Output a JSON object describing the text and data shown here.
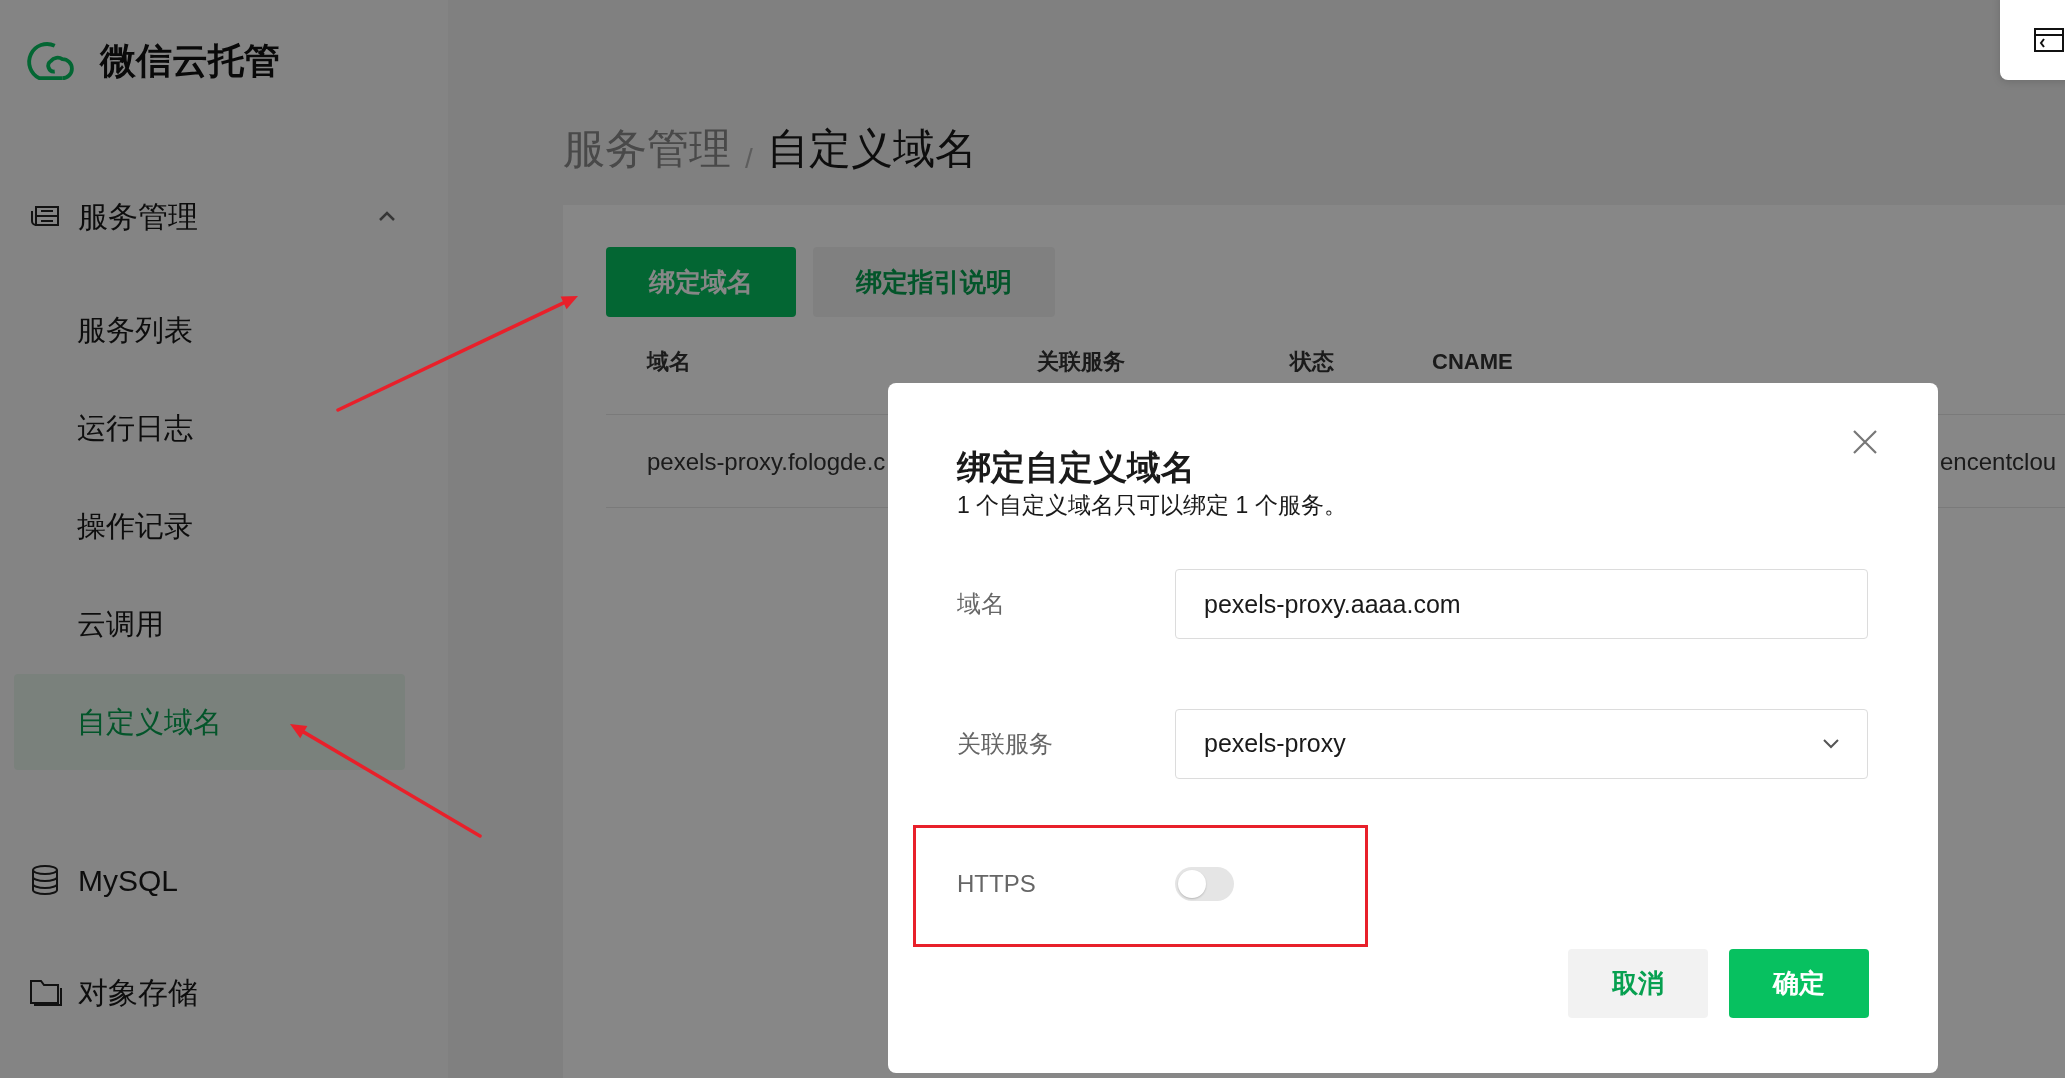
{
  "logo": {
    "text": "微信云托管"
  },
  "sidebar": {
    "groups": [
      {
        "label": "服务管理",
        "expanded": true,
        "items": [
          {
            "label": "服务列表",
            "selected": false
          },
          {
            "label": "运行日志",
            "selected": false
          },
          {
            "label": "操作记录",
            "selected": false
          },
          {
            "label": "云调用",
            "selected": false
          },
          {
            "label": "自定义域名",
            "selected": true
          }
        ]
      },
      {
        "label": "MySQL"
      },
      {
        "label": "对象存储"
      }
    ]
  },
  "breadcrumb": {
    "items": [
      "服务管理",
      "自定义域名"
    ],
    "separator": "/"
  },
  "actions": [
    {
      "label": "绑定域名",
      "kind": "primary"
    },
    {
      "label": "绑定指引说明",
      "kind": "secondary"
    }
  ],
  "table": {
    "columns": [
      "域名",
      "关联服务",
      "状态",
      "CNAME"
    ],
    "rows": [
      {
        "domain": "pexels-proxy.fologde.c",
        "trailing_cell": "encentclou"
      }
    ]
  },
  "modal": {
    "title": "绑定自定义域名",
    "subtitle": "1 个自定义域名只可以绑定 1 个服务。",
    "fields": [
      {
        "kind": "text",
        "label": "域名",
        "value": "pexels-proxy.aaaa.com"
      },
      {
        "kind": "select",
        "label": "关联服务",
        "value": "pexels-proxy"
      },
      {
        "kind": "switch",
        "label": "HTTPS",
        "on": false
      }
    ],
    "buttons": [
      {
        "label": "取消",
        "kind": "secondary"
      },
      {
        "label": "确定",
        "kind": "primary"
      }
    ]
  }
}
